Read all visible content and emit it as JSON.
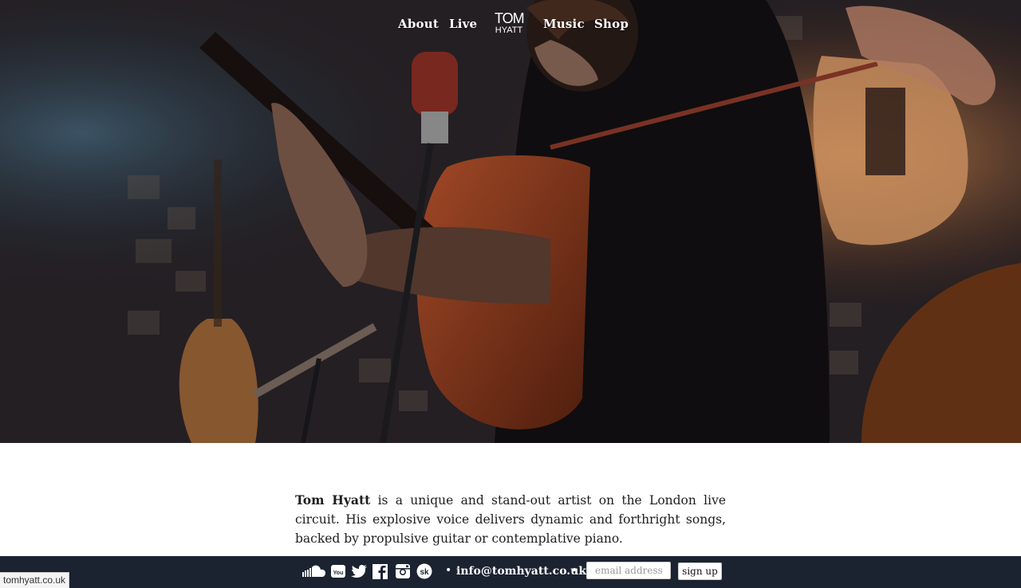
{
  "nav": {
    "about": "About",
    "live": "Live",
    "music": "Music",
    "shop": "Shop",
    "logo_line1": "TOM",
    "logo_line2": "HYATT"
  },
  "hero": {
    "photo": "guitarist-performing-live"
  },
  "bio": {
    "name": "Tom Hyatt",
    "text": " is a unique and stand-out artist on the London live circuit. His explosive voice delivers dynamic and forthright songs, backed by propulsive guitar or contemplative piano."
  },
  "footer": {
    "social_icons": [
      "soundcloud-icon",
      "youtube-icon",
      "twitter-icon",
      "facebook-icon",
      "instagram-icon",
      "songkick-icon"
    ],
    "separator": "•",
    "email": "info@tomhyatt.co.uk",
    "email_placeholder": "email address",
    "signup_label": "sign up",
    "background": "#1b2331"
  },
  "status_url": "tomhyatt.co.uk"
}
